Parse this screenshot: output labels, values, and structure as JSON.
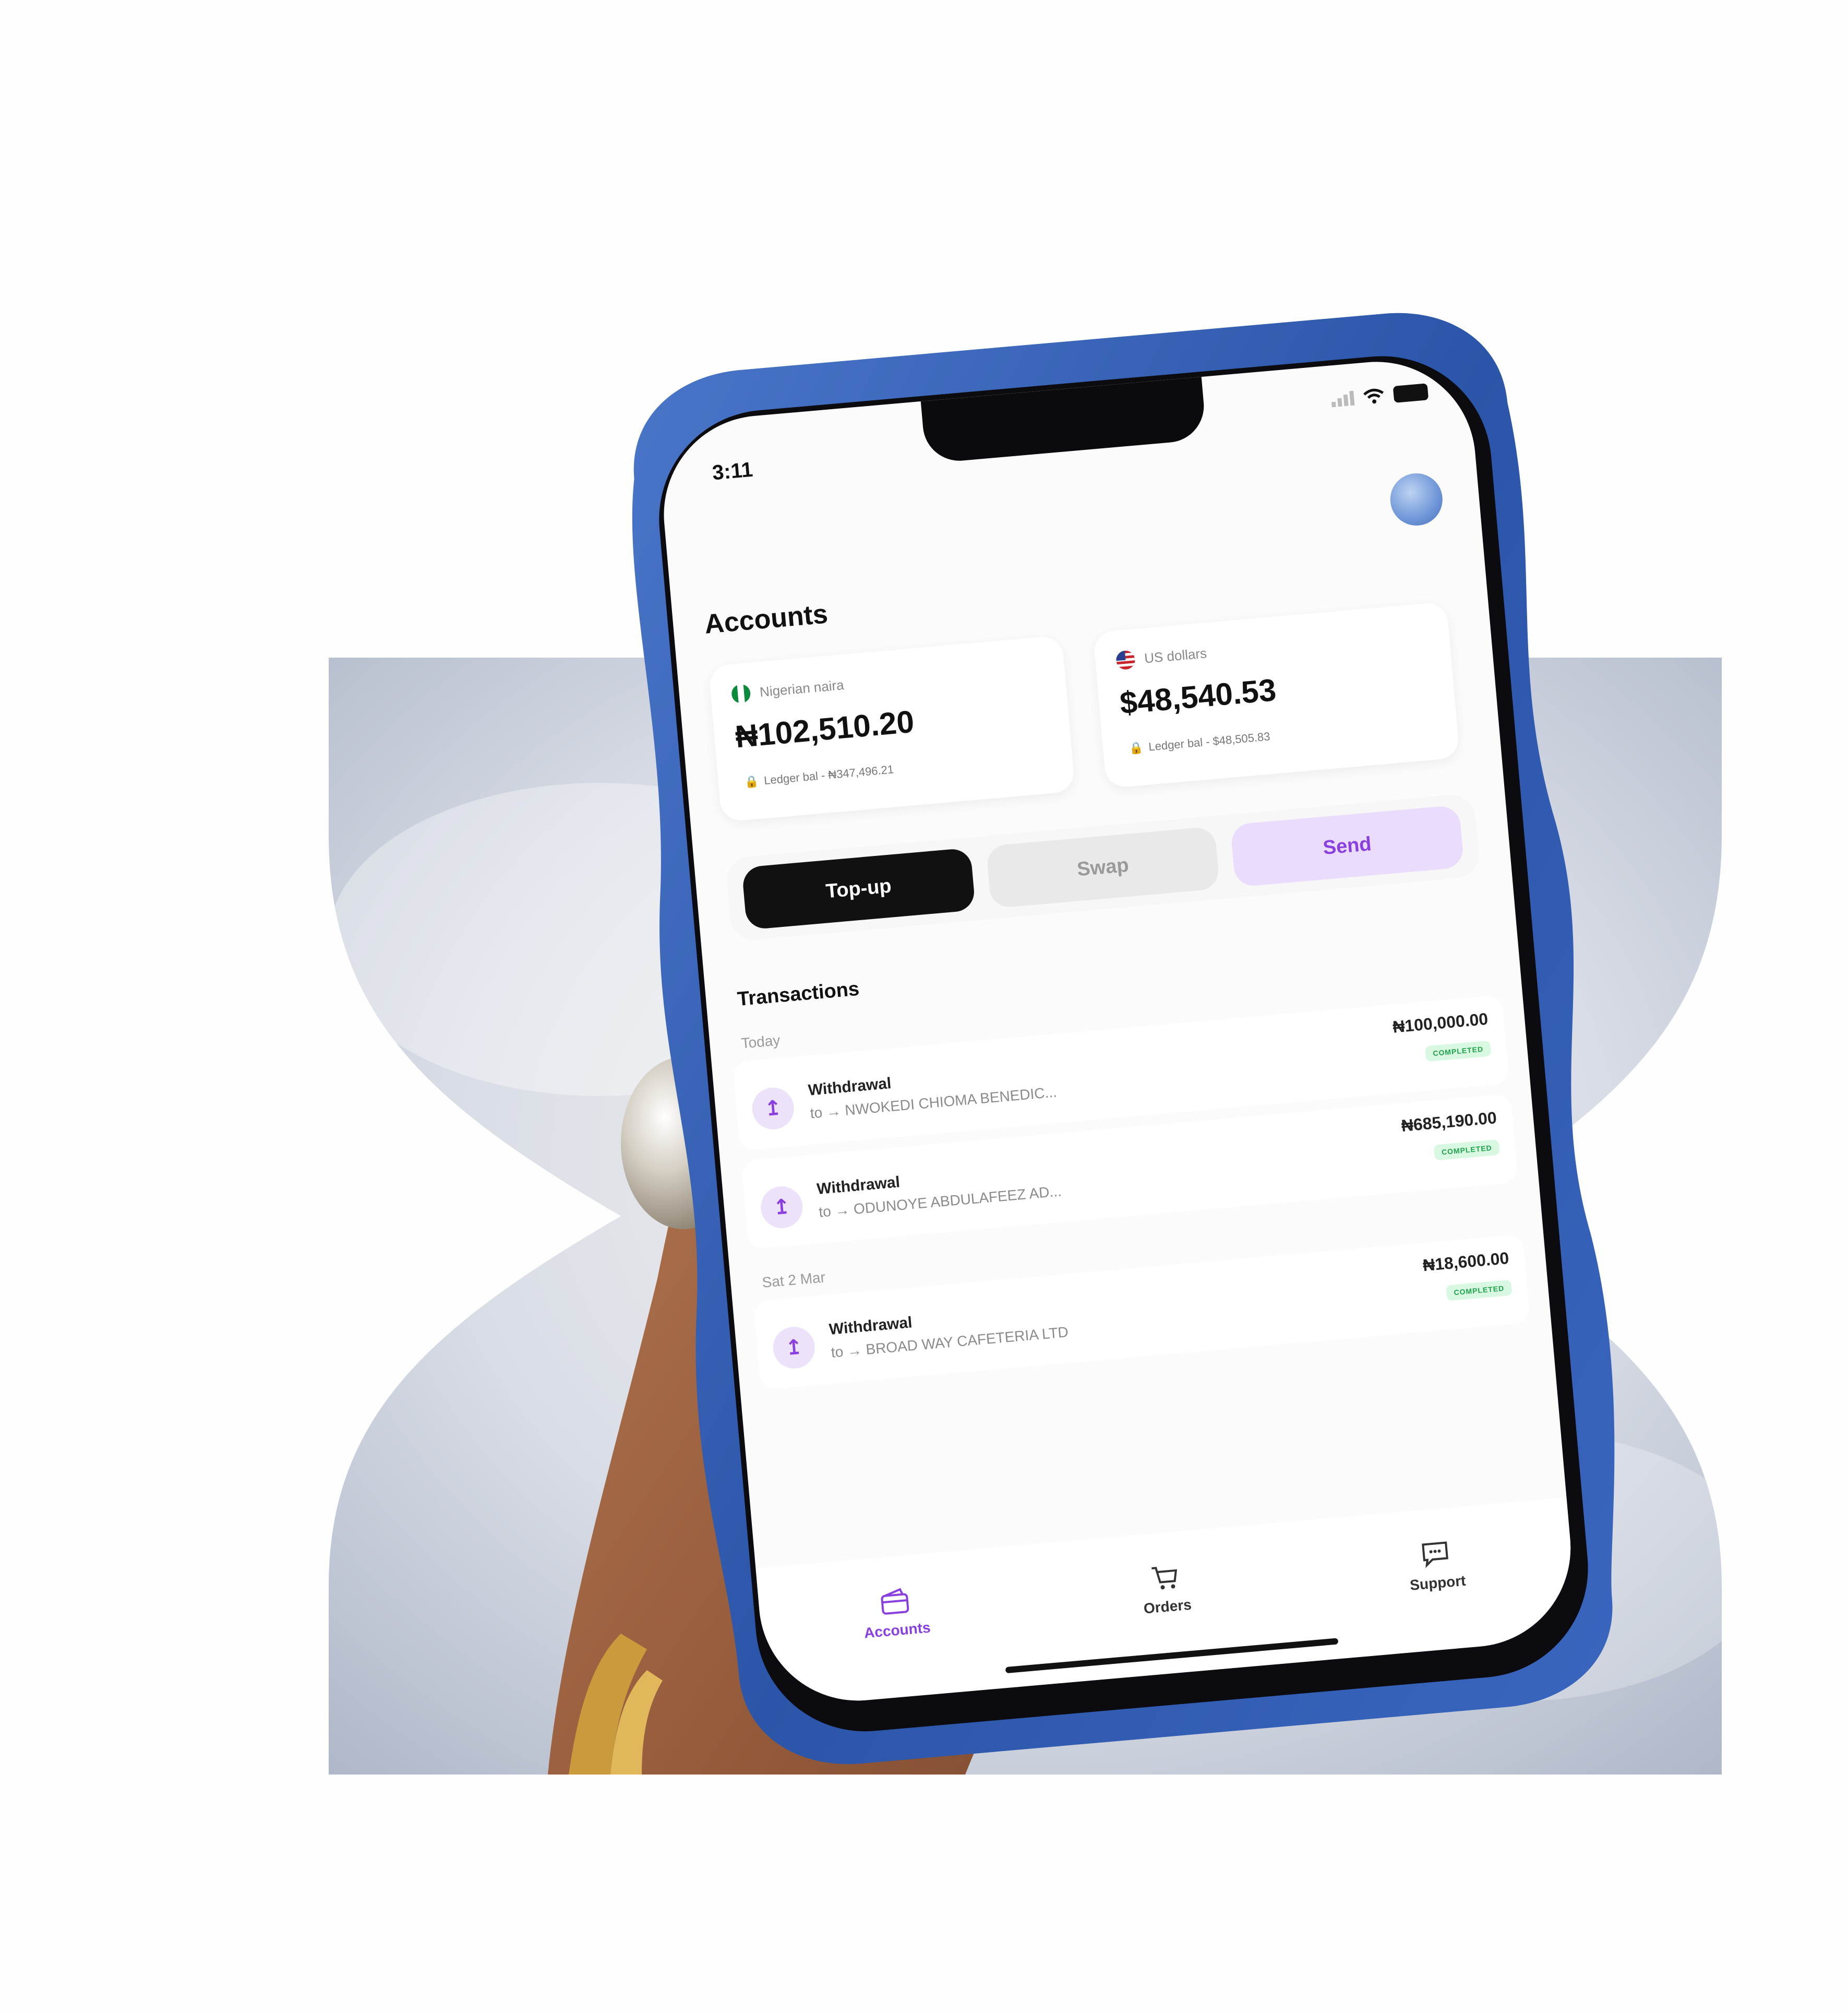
{
  "status_bar": {
    "time": "3:11"
  },
  "page_title": "Accounts",
  "accounts": [
    {
      "currency_name": "Nigerian naira",
      "balance": "₦102,510.20",
      "ledger": "Ledger bal - ₦347,496.21",
      "flag": "nigeria-flag"
    },
    {
      "currency_name": "US dollars",
      "balance": "$48,540.53",
      "ledger": "Ledger bal - $48,505.83",
      "flag": "us-flag"
    }
  ],
  "actions": {
    "topup": "Top-up",
    "swap": "Swap",
    "send": "Send"
  },
  "transactions": {
    "title": "Transactions",
    "groups": [
      {
        "date": "Today",
        "items": [
          {
            "type": "Withdrawal",
            "to": "to → NWOKEDI CHIOMA BENEDIC...",
            "amount": "₦100,000.00",
            "status": "COMPLETED"
          },
          {
            "type": "Withdrawal",
            "to": "to → ODUNOYE ABDULAFEEZ AD...",
            "amount": "₦685,190.00",
            "status": "COMPLETED"
          }
        ]
      },
      {
        "date": "Sat 2 Mar",
        "items": [
          {
            "type": "Withdrawal",
            "to": "to → BROAD WAY CAFETERIA LTD",
            "amount": "₦18,600.00",
            "status": "COMPLETED"
          }
        ]
      }
    ]
  },
  "bottom_nav": {
    "accounts": "Accounts",
    "orders": "Orders",
    "support": "Support"
  },
  "colors": {
    "accent": "#8a3fe0",
    "status_green": "#1fa34a",
    "phone_case": "#2f5bb0"
  }
}
